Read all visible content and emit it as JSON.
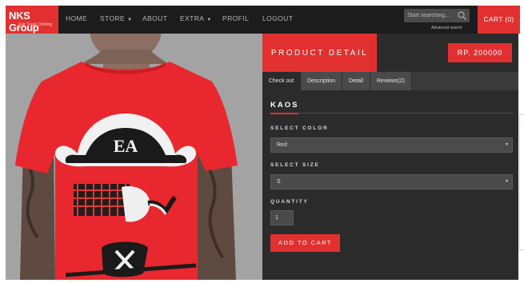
{
  "brand": {
    "name": "NKS Group",
    "tagline": "Fair Trade Clothing"
  },
  "nav": {
    "items": [
      {
        "label": "HOME",
        "caret": false
      },
      {
        "label": "STORE",
        "caret": true
      },
      {
        "label": "ABOUT",
        "caret": false
      },
      {
        "label": "EXTRA",
        "caret": true
      },
      {
        "label": "PROFIL",
        "caret": false
      },
      {
        "label": "LOGOUT",
        "caret": false
      }
    ],
    "search_placeholder": "Start searching...",
    "advanced_search": "Advanced search",
    "cart_label": "CART (0)"
  },
  "panel": {
    "header": "PRODUCT DETAIL",
    "price": "RP. 200000",
    "tabs": [
      "Check out",
      "Description",
      "Detail",
      "Reviews(2)"
    ],
    "active_tab": 0,
    "product_name": "KAOS",
    "color_label": "SELECT COLOR",
    "color_value": "Red",
    "size_label": "SELECT SIZE",
    "size_value": "S",
    "quantity_label": "QUANTITY",
    "quantity_value": "1",
    "add_to_cart": "ADD TO CART"
  },
  "colors": {
    "accent": "#e23030",
    "navbar": "#1c1c1c",
    "panel": "#2b2b2b",
    "photo_bg": "#a3a3a3"
  },
  "icons": {
    "search": "search-icon",
    "caret": "caret-down-icon"
  }
}
